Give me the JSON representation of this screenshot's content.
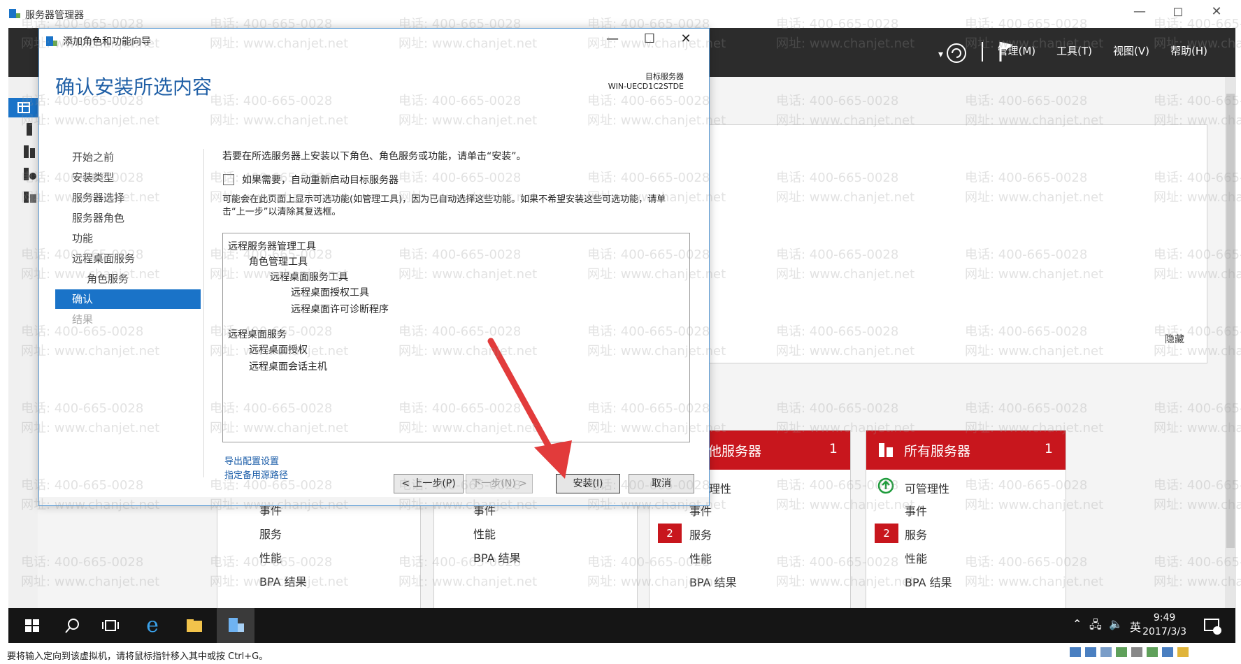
{
  "vm_window": {
    "title": "服务器管理器",
    "minimize": "—",
    "restore": "◻",
    "close": "✕"
  },
  "server_manager": {
    "menus": [
      "管理(M)",
      "工具(T)",
      "视图(V)",
      "帮助(H)"
    ],
    "hide_link": "隐藏",
    "tiles": [
      {
        "title": "",
        "count": "",
        "rows": [
          "事件",
          "服务",
          "性能",
          "BPA 结果"
        ]
      },
      {
        "title": "",
        "count": "",
        "rows": [
          "事件",
          "性能",
          "BPA 结果"
        ]
      },
      {
        "title": "他服务器",
        "count": "1",
        "first_row": "理性",
        "rows": [
          "事件",
          "服务",
          "性能",
          "BPA 结果"
        ],
        "badge": "2"
      },
      {
        "title": "所有服务器",
        "count": "1",
        "first_row": "可管理性",
        "rows": [
          "事件",
          "服务",
          "性能",
          "BPA 结果"
        ],
        "badge": "2"
      }
    ]
  },
  "wizard": {
    "title": "添加角色和功能向导",
    "heading": "确认安装所选内容",
    "target_label": "目标服务器",
    "target_server": "WIN-UECD1C2STDE",
    "steps": [
      {
        "label": "开始之前",
        "state": "normal"
      },
      {
        "label": "安装类型",
        "state": "normal"
      },
      {
        "label": "服务器选择",
        "state": "normal"
      },
      {
        "label": "服务器角色",
        "state": "normal"
      },
      {
        "label": "功能",
        "state": "normal"
      },
      {
        "label": "远程桌面服务",
        "state": "normal"
      },
      {
        "label": "角色服务",
        "state": "sub"
      },
      {
        "label": "确认",
        "state": "active"
      },
      {
        "label": "结果",
        "state": "disabled"
      }
    ],
    "intro": "若要在所选服务器上安装以下角色、角色服务或功能，请单击“安装”。",
    "restart_checkbox": {
      "label": "如果需要，自动重新启动目标服务器",
      "checked": false
    },
    "note": "可能会在此页面上显示可选功能(如管理工具)，因为已自动选择这些功能。如果不希望安装这些可选功能，请单击“上一步”以清除其复选框。",
    "items": [
      {
        "label": "远程服务器管理工具",
        "level": 0
      },
      {
        "label": "角色管理工具",
        "level": 1
      },
      {
        "label": "远程桌面服务工具",
        "level": 2
      },
      {
        "label": "远程桌面授权工具",
        "level": 3
      },
      {
        "label": "远程桌面许可诊断程序",
        "level": 3
      },
      {
        "label": "远程桌面服务",
        "level": 0
      },
      {
        "label": "远程桌面授权",
        "level": 1
      },
      {
        "label": "远程桌面会话主机",
        "level": 1
      }
    ],
    "export_link": "导出配置设置",
    "alt_source_link": "指定备用源路径",
    "buttons": {
      "prev": "< 上一步(P)",
      "next": "下一步(N) >",
      "install": "安装(I)",
      "cancel": "取消"
    }
  },
  "taskbar": {
    "time": "9:49",
    "date": "2017/3/3",
    "ime": "英"
  },
  "statusbar": {
    "message": "要将输入定向到该虚拟机，请将鼠标指针移入其中或按 Ctrl+G。"
  },
  "watermark": {
    "phone": "电话: 400-665-0028",
    "site": "网址: www.chanjet.net"
  },
  "colors": {
    "accent_blue": "#1a73c8",
    "tile_red": "#c8161d",
    "arrow_red": "#e23b3b"
  }
}
